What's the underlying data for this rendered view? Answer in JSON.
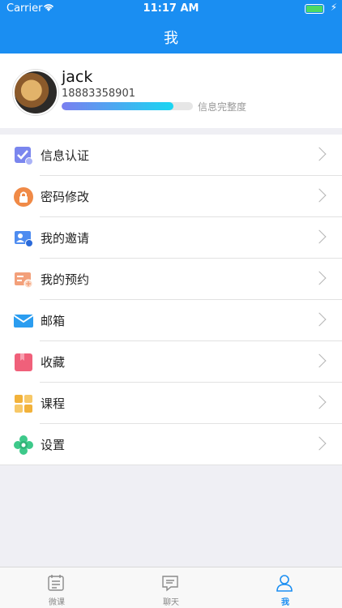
{
  "status_bar": {
    "carrier": "Carrier",
    "time": "11:17 AM"
  },
  "nav": {
    "title": "我"
  },
  "profile": {
    "name": "jack",
    "phone": "18883358901",
    "completion_label": "信息完整度",
    "completion_fraction": 0.85
  },
  "menu": [
    {
      "label": "信息认证",
      "icon": "verify-icon",
      "color": "#7a86ee"
    },
    {
      "label": "密码修改",
      "icon": "lock-icon",
      "color": "#f08a47"
    },
    {
      "label": "我的邀请",
      "icon": "invite-icon",
      "color": "#4e8cf0"
    },
    {
      "label": "我的预约",
      "icon": "appointment-icon",
      "color": "#f3a07a"
    },
    {
      "label": "邮箱",
      "icon": "mail-icon",
      "color": "#2b9df0"
    },
    {
      "label": "收藏",
      "icon": "favorite-icon",
      "color": "#f0607a"
    },
    {
      "label": "课程",
      "icon": "course-icon",
      "color": "#f2b23a"
    },
    {
      "label": "设置",
      "icon": "settings-icon",
      "color": "#3dc98a"
    }
  ],
  "tabs": [
    {
      "label": "微课",
      "icon": "calendar-icon",
      "active": false
    },
    {
      "label": "聊天",
      "icon": "chat-icon",
      "active": false
    },
    {
      "label": "我",
      "icon": "person-icon",
      "active": true
    }
  ],
  "colors": {
    "primary": "#1a8ef2",
    "background": "#efeff4"
  }
}
